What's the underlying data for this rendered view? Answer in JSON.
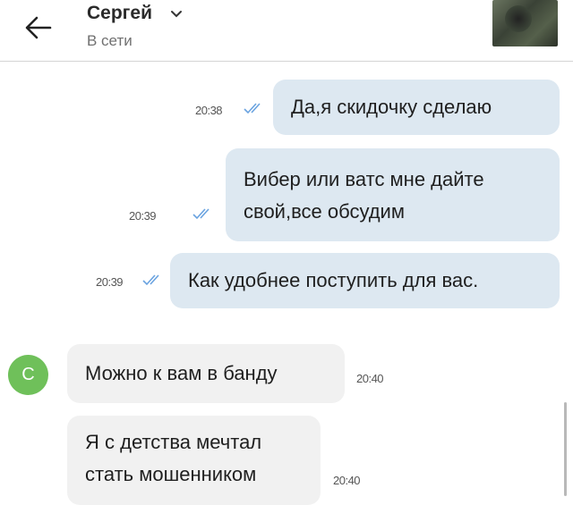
{
  "header": {
    "contact_name": "Сергей",
    "status": "В сети"
  },
  "messages": [
    {
      "direction": "outgoing",
      "lines": [
        "Да,я скидочку сделаю"
      ],
      "time": "20:38",
      "read": true
    },
    {
      "direction": "outgoing",
      "lines": [
        "Вибер или ватс мне дайте",
        "свой,все обсудим"
      ],
      "time": "20:39",
      "read": true
    },
    {
      "direction": "outgoing",
      "lines": [
        "Как удобнее поступить для вас."
      ],
      "time": "20:39",
      "read": true
    },
    {
      "direction": "incoming",
      "lines": [
        "Можно к вам в банду"
      ],
      "time": "20:40",
      "sender_initial": "С"
    },
    {
      "direction": "incoming",
      "lines": [
        "Я с детства мечтал",
        "стать мошенником"
      ],
      "time": "20:40"
    }
  ],
  "colors": {
    "outgoing_bubble": "#dde8f1",
    "incoming_bubble": "#f1f1f1",
    "sender_avatar": "#6fc05a",
    "read_ticks": "#6aa3e0"
  },
  "icons": [
    "back-arrow-icon",
    "chevron-down-icon",
    "double-check-icon",
    "contact-photo"
  ]
}
